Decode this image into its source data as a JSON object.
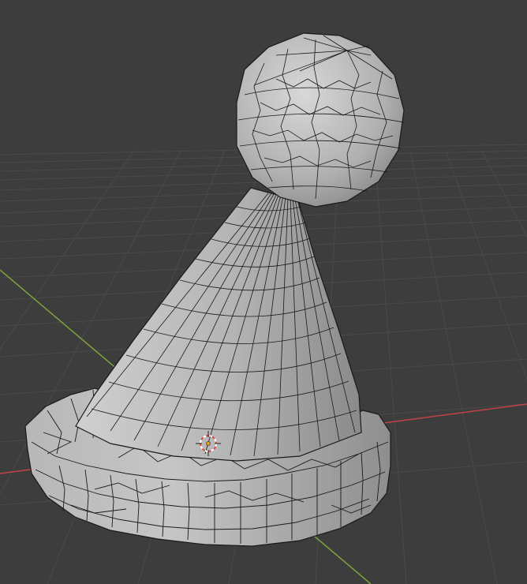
{
  "viewport": {
    "background": "#3d3d3d",
    "grid_color": "#4a4a4a",
    "x_axis_color": "#c1434a",
    "y_axis_color": "#7da33a",
    "mesh_fill": "#b9b9b9",
    "mesh_shadow": "#8f8f8f",
    "mesh_highlight": "#d6d6d6",
    "wire_color": "#1a1a1a",
    "cursor_colors": {
      "ring_a": "#e14c3c",
      "ring_b": "#ffffff",
      "origin": "#f0a020"
    }
  },
  "scene": {
    "object": "party-hat-mesh",
    "parts": [
      "cone",
      "pompom",
      "fur-brim"
    ],
    "selected": false
  }
}
